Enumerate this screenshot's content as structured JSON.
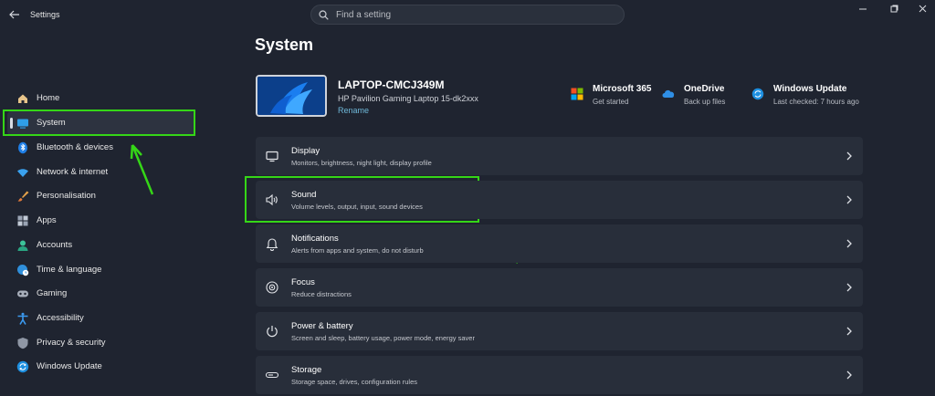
{
  "app": {
    "title": "Settings"
  },
  "search": {
    "placeholder": "Find a setting"
  },
  "page": {
    "title": "System"
  },
  "device": {
    "name": "LAPTOP-CMCJ349M",
    "model": "HP Pavilion Gaming Laptop 15-dk2xxx",
    "rename": "Rename"
  },
  "tiles": [
    {
      "title": "Microsoft 365",
      "subtitle": "Get started",
      "icon": "microsoft-365-icon"
    },
    {
      "title": "OneDrive",
      "subtitle": "Back up files",
      "icon": "onedrive-icon"
    },
    {
      "title": "Windows Update",
      "subtitle": "Last checked: 7 hours ago",
      "icon": "windows-update-icon"
    }
  ],
  "sidebar": {
    "selected": "System",
    "items": [
      {
        "label": "Home",
        "icon": "home-icon"
      },
      {
        "label": "System",
        "icon": "system-icon"
      },
      {
        "label": "Bluetooth & devices",
        "icon": "bluetooth-icon"
      },
      {
        "label": "Network & internet",
        "icon": "wifi-icon"
      },
      {
        "label": "Personalisation",
        "icon": "brush-icon"
      },
      {
        "label": "Apps",
        "icon": "apps-icon"
      },
      {
        "label": "Accounts",
        "icon": "account-icon"
      },
      {
        "label": "Time & language",
        "icon": "globe-clock-icon"
      },
      {
        "label": "Gaming",
        "icon": "gamepad-icon"
      },
      {
        "label": "Accessibility",
        "icon": "accessibility-icon"
      },
      {
        "label": "Privacy & security",
        "icon": "shield-icon"
      },
      {
        "label": "Windows Update",
        "icon": "windows-update-icon"
      }
    ]
  },
  "settings": [
    {
      "title": "Display",
      "subtitle": "Monitors, brightness, night light, display profile",
      "icon": "monitor-icon"
    },
    {
      "title": "Sound",
      "subtitle": "Volume levels, output, input, sound devices",
      "icon": "speaker-icon"
    },
    {
      "title": "Notifications",
      "subtitle": "Alerts from apps and system, do not disturb",
      "icon": "bell-icon"
    },
    {
      "title": "Focus",
      "subtitle": "Reduce distractions",
      "icon": "focus-icon"
    },
    {
      "title": "Power & battery",
      "subtitle": "Screen and sleep, battery usage, power mode, energy saver",
      "icon": "power-icon"
    },
    {
      "title": "Storage",
      "subtitle": "Storage space, drives, configuration rules",
      "icon": "storage-icon"
    }
  ],
  "colors": {
    "background": "#1f2430",
    "card": "#282e3a",
    "annotation": "#35d617",
    "accent": "#4cc2ff",
    "link": "#6fb8d9"
  }
}
